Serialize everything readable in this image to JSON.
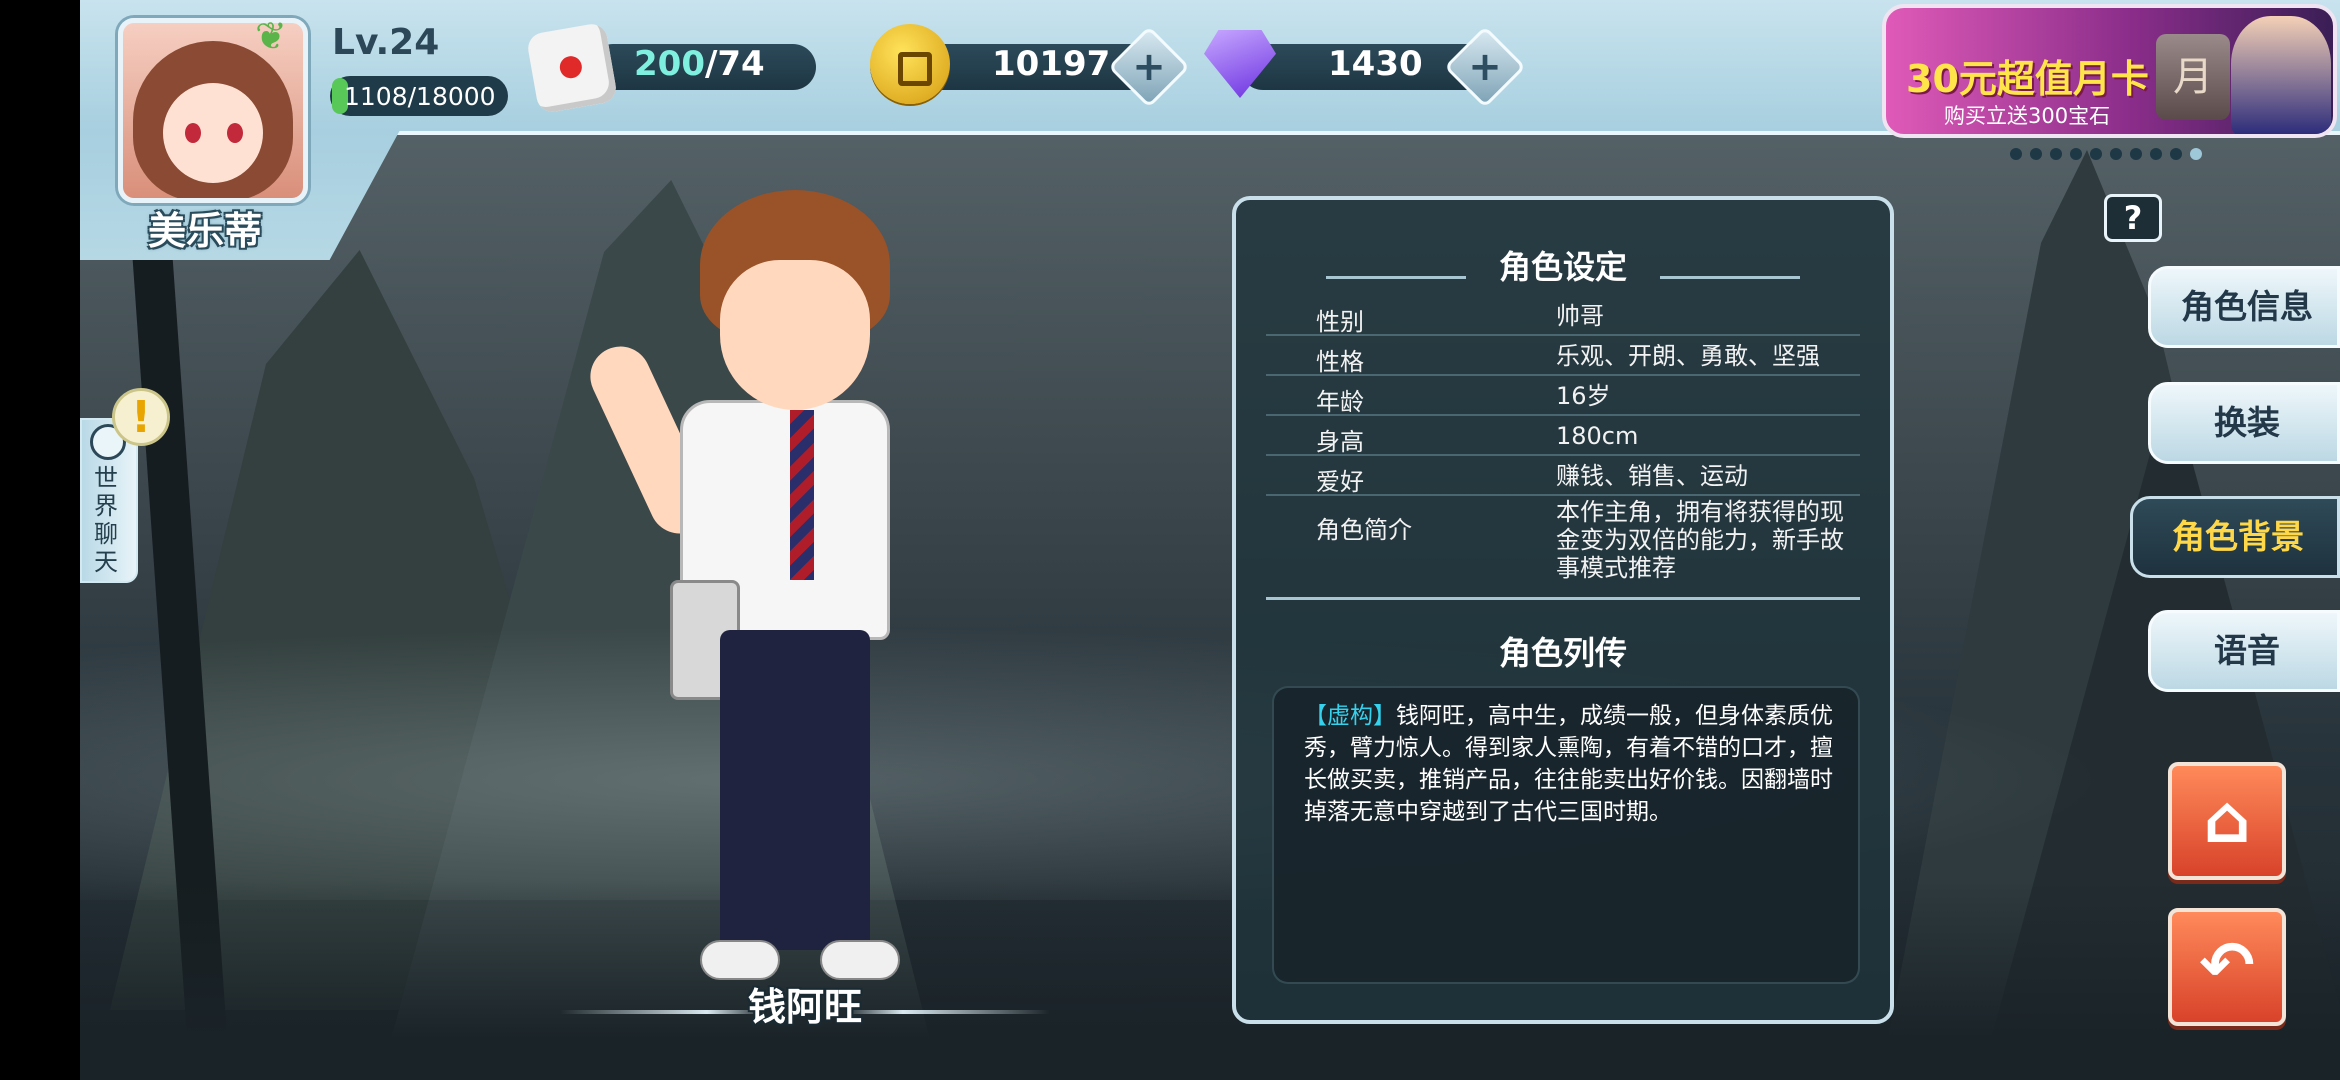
{
  "player": {
    "name": "美乐蒂",
    "level": "Lv.24",
    "exp_text": "1108/18000",
    "exp_fraction": 0.0616
  },
  "resources": {
    "stamina_current": "200",
    "stamina_max": "/74",
    "gold": "10197",
    "gems": "1430",
    "plus_symbol": "+"
  },
  "banner": {
    "title": "30元超值月卡",
    "subtitle": "购买立送300宝石",
    "badge": "月",
    "page_count": 10,
    "active_page": 9
  },
  "chat": {
    "label": "世界聊天",
    "alert": "!"
  },
  "character": {
    "name": "钱阿旺"
  },
  "panel": {
    "settings_title": "角色设定",
    "rows": [
      {
        "label": "性别",
        "value": "帅哥"
      },
      {
        "label": "性格",
        "value": "乐观、开朗、勇敢、坚强"
      },
      {
        "label": "年龄",
        "value": "16岁"
      },
      {
        "label": "身高",
        "value": "180cm"
      },
      {
        "label": "爱好",
        "value": "赚钱、销售、运动"
      },
      {
        "label": "角色简介",
        "value": "本作主角，拥有将获得的现金变为双倍的能力，新手故事模式推荐"
      }
    ],
    "bio_title": "角色列传",
    "bio_tag": "【虚构】",
    "bio_text": "钱阿旺，高中生，成绩一般，但身体素质优秀，臂力惊人。得到家人熏陶，有着不错的口才，擅长做买卖，推销产品，往往能卖出好价钱。因翻墙时掉落无意中穿越到了古代三国时期。"
  },
  "help": "?",
  "tabs": [
    {
      "label": "角色信息",
      "active": false
    },
    {
      "label": "换装",
      "active": false
    },
    {
      "label": "角色背景",
      "active": true
    },
    {
      "label": "语音",
      "active": false
    }
  ],
  "buttons": {
    "home_icon": "home-icon",
    "back_icon": "back-icon"
  },
  "colors": {
    "accent_active_tab": "#ffd84a",
    "bio_tag": "#35d2ee",
    "topbar": "#b6d8e5"
  }
}
